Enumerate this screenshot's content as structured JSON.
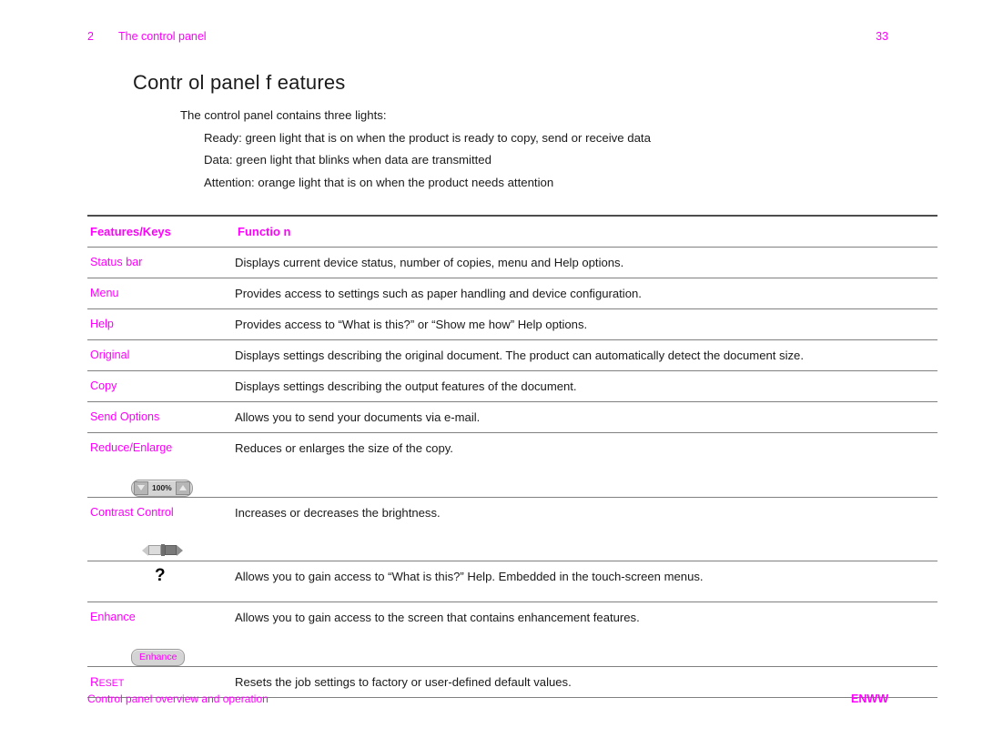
{
  "header": {
    "chapter_number": "2",
    "chapter_title": "The control panel",
    "page_number": "33"
  },
  "title": "Contr ol panel f eatures",
  "intro": {
    "lead": "The control panel contains three lights:",
    "items": [
      "Ready: green light that is on when the product is ready to copy, send or receive data",
      "Data: green light that blinks when data are transmitted",
      "Attention: orange light that is on when the product needs attention"
    ]
  },
  "table": {
    "columns": {
      "key": "Features/Keys",
      "function": "Functio n"
    },
    "rows": [
      {
        "key": "Status bar",
        "function": "Displays current device status, number of copies, menu and Help options.",
        "widget": "none"
      },
      {
        "key": "Menu",
        "function": "Provides access to settings such as paper handling and device configuration.",
        "widget": "none"
      },
      {
        "key": "Help",
        "function": "Provides access to “What is this?” or “Show me how” Help options.",
        "widget": "none"
      },
      {
        "key": "Original",
        "function": "Displays settings describing the original document. The product can automatically detect the document size.",
        "widget": "none"
      },
      {
        "key": "Copy",
        "function": "Displays settings describing the output features of the document.",
        "widget": "none"
      },
      {
        "key": "Send Options",
        "function": "Allows you to send your documents via e-mail.",
        "widget": "none"
      },
      {
        "key": "Reduce/Enlarge",
        "function": "Reduces or enlarges the size of the copy.",
        "widget": "stepper"
      },
      {
        "key": "Contrast Control",
        "function": "Increases or decreases the brightness.",
        "widget": "slider"
      },
      {
        "key": "",
        "function": "Allows you to gain access to “What is this?” Help. Embedded in the touch-screen menus.",
        "widget": "qmark"
      },
      {
        "key": "Enhance",
        "function": "Allows you to gain access to the screen that contains enhancement features.",
        "widget": "enhance"
      },
      {
        "key": "RESET",
        "key_smallcaps_first": "R",
        "key_smallcaps_rest": "ESET",
        "function": "Resets the job settings to factory or user-defined default values.",
        "widget": "none"
      }
    ]
  },
  "widgets": {
    "stepper": {
      "value": "100%",
      "decrease_icon": "triangle-down-icon",
      "increase_icon": "triangle-up-icon"
    },
    "slider": {
      "decrease_icon": "triangle-left-icon",
      "increase_icon": "triangle-right-icon"
    },
    "qmark": {
      "label": "?"
    },
    "enhance": {
      "label": "Enhance"
    }
  },
  "footer": {
    "left": "Control panel overview and operation",
    "right": "ENWW"
  },
  "colors": {
    "accent_magenta": "#ff00ff",
    "body_text": "#1a1a1a",
    "rule": "#808080",
    "widget_face": "#d4d4d4"
  }
}
